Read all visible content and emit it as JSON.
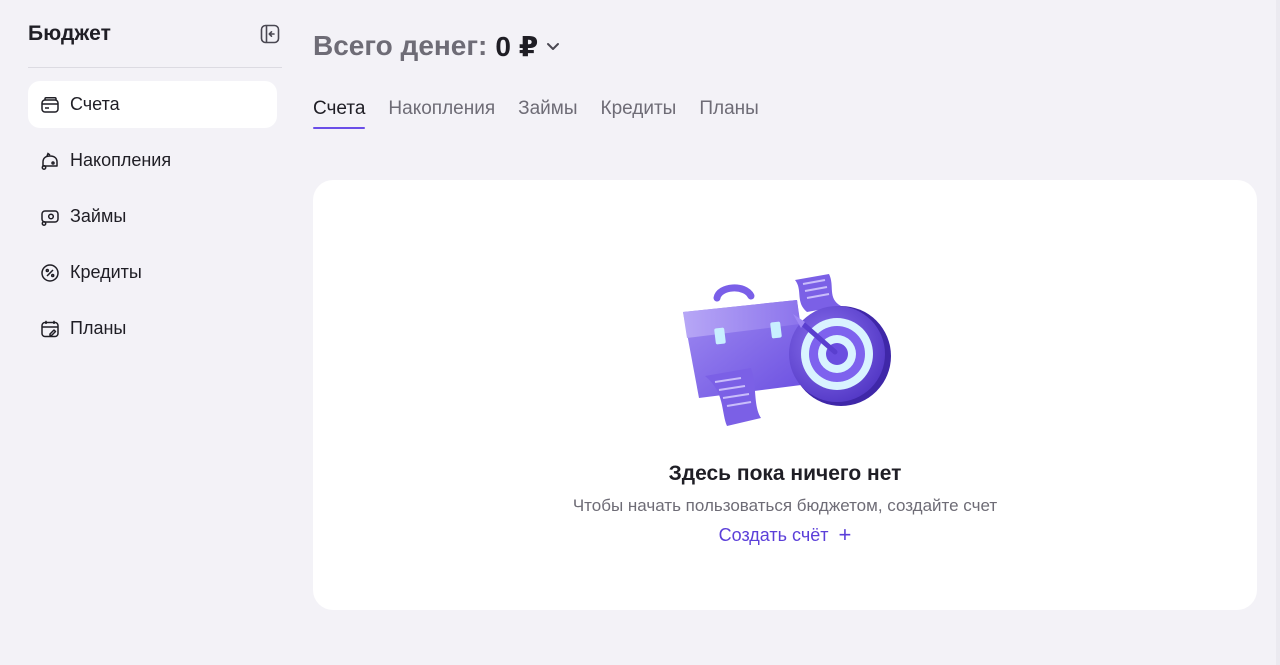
{
  "sidebar": {
    "title": "Бюджет",
    "items": [
      {
        "label": "Счета",
        "icon": "wallet-icon",
        "active": true
      },
      {
        "label": "Накопления",
        "icon": "piggy-bank-icon"
      },
      {
        "label": "Займы",
        "icon": "loan-icon"
      },
      {
        "label": "Кредиты",
        "icon": "percent-icon"
      },
      {
        "label": "Планы",
        "icon": "calendar-icon"
      }
    ],
    "collapse_icon": "collapse-sidebar-icon"
  },
  "header": {
    "total_label": "Всего денег:",
    "total_value": "0 ₽"
  },
  "tabs": [
    {
      "label": "Счета",
      "active": true
    },
    {
      "label": "Накопления"
    },
    {
      "label": "Займы"
    },
    {
      "label": "Кредиты"
    },
    {
      "label": "Планы"
    }
  ],
  "empty_state": {
    "title": "Здесь пока ничего нет",
    "subtitle": "Чтобы начать пользоваться бюджетом, создайте счет",
    "action_label": "Создать счёт",
    "action_icon": "+"
  },
  "colors": {
    "accent": "#6a4ee8",
    "link": "#5b3fd9",
    "background": "#f3f2f7",
    "card": "#ffffff"
  }
}
